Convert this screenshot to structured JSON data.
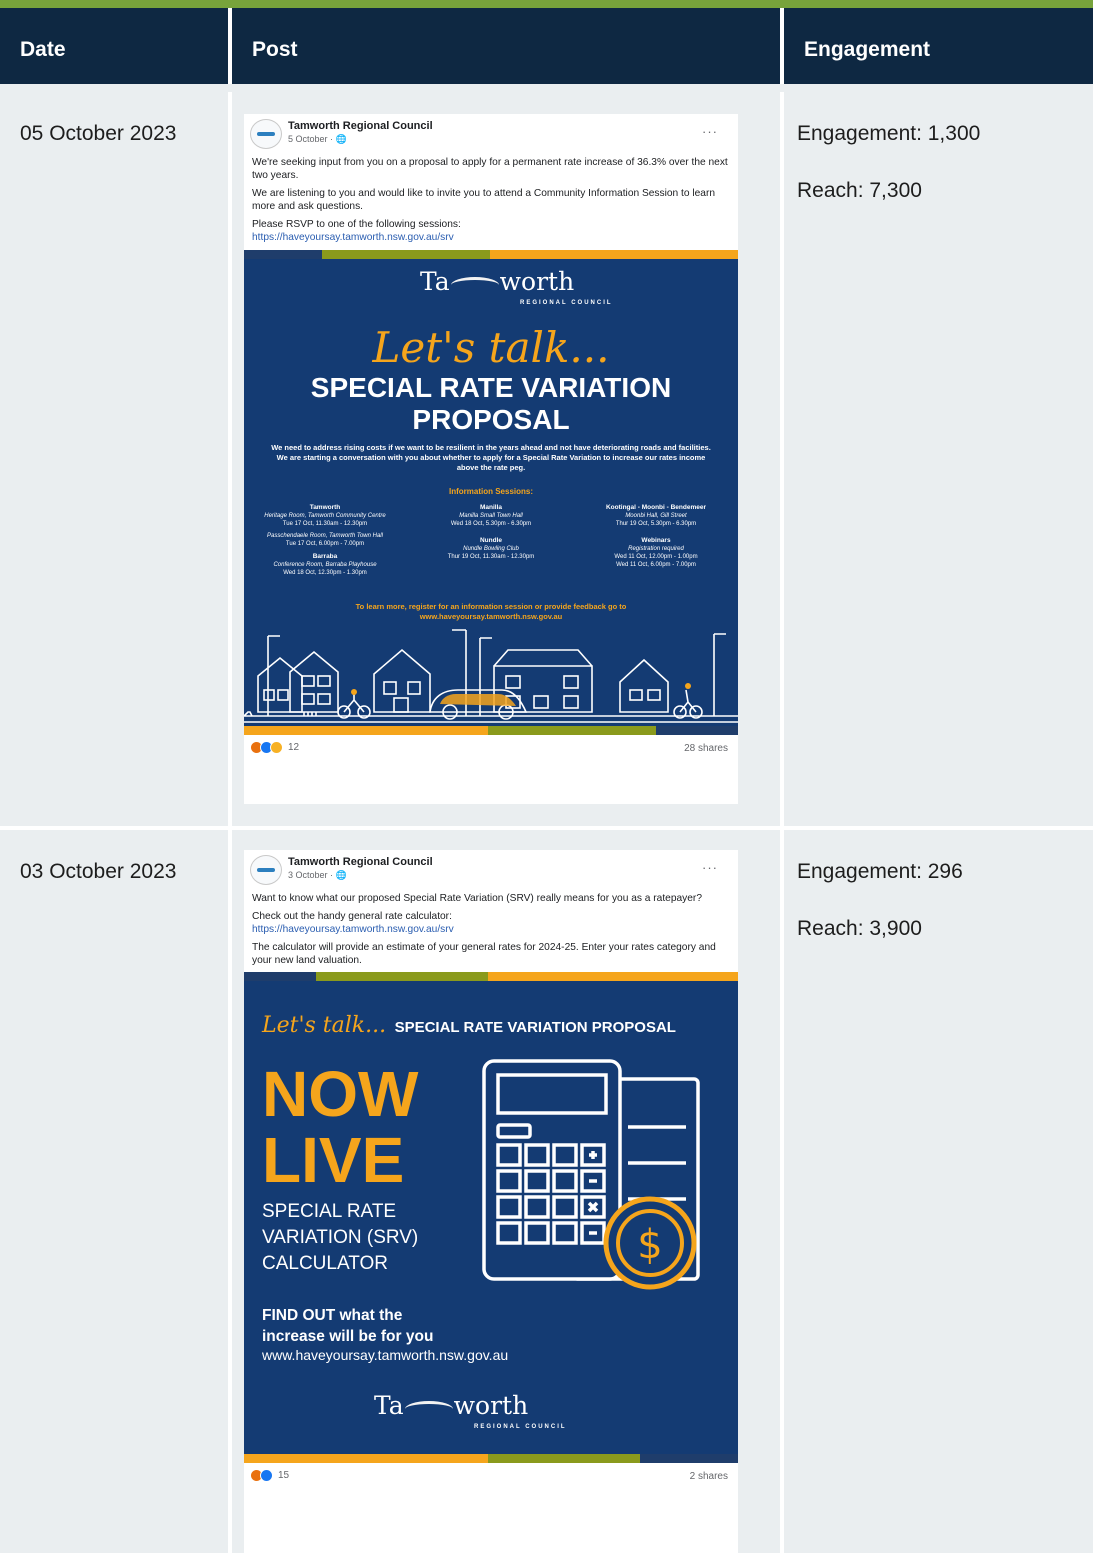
{
  "table": {
    "headers": {
      "date": "Date",
      "post": "Post",
      "engagement": "Engagement"
    }
  },
  "rows": [
    {
      "date": "05 October 2023",
      "engagement": "Engagement: 1,300",
      "reach": "Reach: 7,300",
      "post": {
        "page_name": "Tamworth Regional Council",
        "post_date": "5 October · ",
        "paragraphs": [
          "We're seeking input from you on a proposal to apply for a permanent rate increase of 36.3% over the next two years.",
          "We are listening to you and would like to invite you to attend a Community Information Session to learn more and ask questions.",
          "Please RSVP to one of the following sessions:"
        ],
        "link": "https://haveyoursay.tamworth.nsw.gov.au/srv",
        "reaction_count": "12",
        "shares": "28 shares",
        "poster": {
          "brand_left": "Ta",
          "brand_right": "worth",
          "brand_sub": "REGIONAL COUNCIL",
          "lets_talk": "Let's talk...",
          "title_line1": "SPECIAL RATE VARIATION",
          "title_line2": "PROPOSAL",
          "intro": "We need to address rising costs if we want to be resilient in the years ahead and not have deteriorating roads and facilities. We are starting a conversation with you about whether to apply for a Special Rate Variation to increase our rates income above the rate peg.",
          "sessions_heading": "Information Sessions:",
          "sessions": [
            {
              "town": "Tamworth",
              "venue": "Heritage Room, Tamworth Community Centre",
              "time": "Tue 17 Oct, 11.30am - 12.30pm",
              "venue2": "Passchendaele Room, Tamworth Town Hall",
              "time2": "Tue 17 Oct, 6.00pm - 7.00pm"
            },
            {
              "town": "Barraba",
              "venue": "Conference Room, Barraba Playhouse",
              "time": "Wed 18 Oct, 12.30pm - 1.30pm"
            },
            {
              "town": "Manilla",
              "venue": "Manilla Small Town Hall",
              "time": "Wed 18 Oct, 5.30pm - 6.30pm"
            },
            {
              "town": "Nundle",
              "venue": "Nundle Bowling Club",
              "time": "Thur 19 Oct, 11.30am - 12.30pm"
            },
            {
              "town": "Kootingal - Moonbi - Bendemeer",
              "venue": "Moonbi Hall, Gill Street",
              "time": "Thur 19 Oct, 5.30pm - 6.30pm"
            },
            {
              "town": "Webinars",
              "venue": "Registration required",
              "time": "Wed 11 Oct, 12.00pm - 1.00pm",
              "time2": "Wed 11 Oct, 6.00pm - 7.00pm"
            }
          ],
          "cta_line1": "To learn more, register for an information session or provide feedback go to",
          "cta_line2": "www.haveyoursay.tamworth.nsw.gov.au"
        }
      }
    },
    {
      "date": "03 October 2023",
      "engagement": "Engagement: 296",
      "reach": "Reach: 3,900",
      "post": {
        "page_name": "Tamworth Regional Council",
        "post_date": "3 October · ",
        "paragraphs": [
          "Want to know what our proposed Special Rate Variation (SRV) really means for you as a ratepayer?",
          "Check out the handy general rate calculator:"
        ],
        "link": "https://haveyoursay.tamworth.nsw.gov.au/srv",
        "paragraph_after": "The calculator will provide an estimate of your general rates for 2024-25. Enter your rates category and your new land valuation.",
        "reaction_count": "15",
        "shares": "2 shares",
        "poster": {
          "lets_talk": "Let's talk...",
          "heading": "SPECIAL RATE VARIATION PROPOSAL",
          "now": "NOW",
          "live": "LIVE",
          "calc_line1": "SPECIAL RATE",
          "calc_line2": "VARIATION (SRV)",
          "calc_line3": "CALCULATOR",
          "find_line1": "FIND OUT what the",
          "find_line2": "increase will be for you",
          "url": "www.haveyoursay.tamworth.nsw.gov.au",
          "brand_left": "Ta",
          "brand_right": "worth",
          "brand_sub": "REGIONAL COUNCIL"
        }
      }
    }
  ],
  "colors": {
    "header_bg": "#0e2842",
    "accent_green": "#77a33b",
    "row_bg": "#eaeef0",
    "poster_blue": "#143b73",
    "poster_gold": "#f5a51c",
    "band_olive": "#8a9a1c",
    "band_navy": "#1f3d6b"
  },
  "icons": [
    "globe-icon",
    "more-options-icon",
    "angry-reaction-icon",
    "like-reaction-icon",
    "care-reaction-icon",
    "calculator-icon",
    "dollar-coin-icon",
    "houses-illustration"
  ]
}
